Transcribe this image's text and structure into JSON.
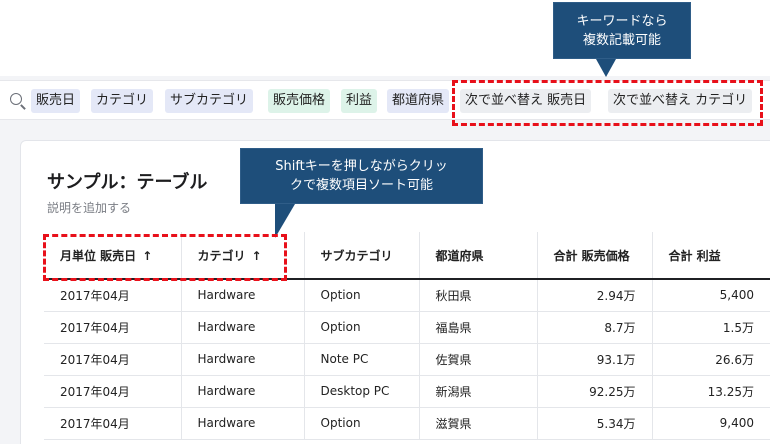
{
  "search": {
    "chips": [
      {
        "label": "販売日",
        "style": "blue"
      },
      {
        "label": "カテゴリ",
        "style": "blue"
      },
      {
        "label": "サブカテゴリ",
        "style": "blue"
      },
      {
        "label": "販売価格",
        "style": "green"
      },
      {
        "label": "利益",
        "style": "green"
      },
      {
        "label": "都道府県",
        "style": "blue"
      },
      {
        "label": "次で並べ替え 販売日",
        "style": "gray"
      },
      {
        "label": "次で並べ替え カテゴリ",
        "style": "gray"
      }
    ]
  },
  "callouts": {
    "keyword": {
      "line1": "キーワードなら",
      "line2": "複数記載可能"
    },
    "shift": {
      "line1": "Shiftキーを押しながらクリッ",
      "line2": "クで複数項目ソート可能"
    }
  },
  "card": {
    "title": "サンプル：テーブル",
    "description": "説明を追加する"
  },
  "table": {
    "headers": [
      {
        "label": "月単位 販売日",
        "sort": "↑"
      },
      {
        "label": "カテゴリ",
        "sort": "↑"
      },
      {
        "label": "サブカテゴリ",
        "sort": ""
      },
      {
        "label": "都道府県",
        "sort": ""
      },
      {
        "label": "合計 販売価格",
        "sort": ""
      },
      {
        "label": "合計 利益",
        "sort": ""
      }
    ],
    "rows": [
      [
        "2017年04月",
        "Hardware",
        "Option",
        "秋田県",
        "2.94万",
        "5,400"
      ],
      [
        "2017年04月",
        "Hardware",
        "Option",
        "福島県",
        "8.7万",
        "1.5万"
      ],
      [
        "2017年04月",
        "Hardware",
        "Note PC",
        "佐賀県",
        "93.1万",
        "26.6万"
      ],
      [
        "2017年04月",
        "Hardware",
        "Desktop PC",
        "新潟県",
        "92.25万",
        "13.25万"
      ],
      [
        "2017年04月",
        "Hardware",
        "Option",
        "滋賀県",
        "5.34万",
        "9,400"
      ]
    ]
  },
  "colors": {
    "highlight": "#e8101a",
    "callout_bg": "#1e4e7a",
    "chip_blue": "#e4e8f7",
    "chip_green": "#ddf3e9",
    "chip_gray": "#eceef1"
  }
}
